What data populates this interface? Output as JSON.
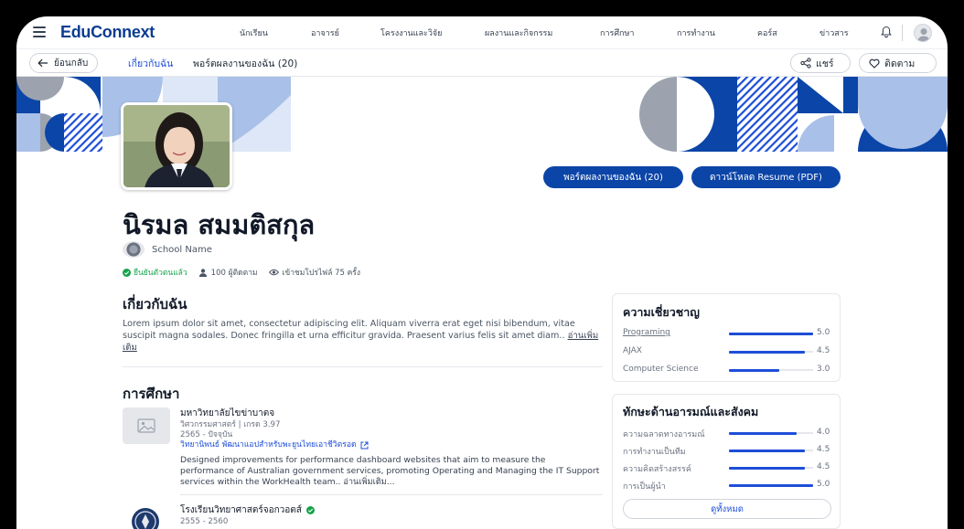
{
  "app": {
    "logo": "EduConnext"
  },
  "topnav": {
    "menu": [
      "นักเรียน",
      "อาจารย์",
      "โครงงานและวิจัย",
      "ผลงานและกิจกรรม",
      "การศึกษา",
      "การทำงาน",
      "คอร์ส",
      "ข่าวสาร"
    ]
  },
  "subnav": {
    "back_label": "ย้อนกลับ",
    "tabs": [
      {
        "label": "เกี่ยวกับฉัน",
        "active": true
      },
      {
        "label": "พอร์ตผลงานของฉัน (20)",
        "active": false
      }
    ],
    "share_label": "แชร์",
    "follow_label": "ติดตาม"
  },
  "profile": {
    "portfolio_button": "พอร์ตผลงานของฉัน (20)",
    "resume_button": "ดาวน์โหลด Resume (PDF)",
    "name": "นิรมล สมมติสกุล",
    "school": "School Name",
    "verified": "ยืนยันตัวตนแล้ว",
    "followers": "100 ผู้ติดตาม",
    "views": "เข้าชมโปรไฟล์ 75 ครั้ง"
  },
  "about": {
    "title": "เกี่ยวกับฉัน",
    "text": "Lorem ipsum dolor sit amet, consectetur adipiscing elit. Aliquam viverra erat eget nisi bibendum, vitae suscipit magna sodales. Donec fringilla et urna efficitur gravida. Praesent varius felis sit amet diam..",
    "readmore": "อ่านเพิ่มเติม"
  },
  "education": {
    "title": "การศึกษา",
    "items": [
      {
        "school": "มหาวิทยาลัยไขข่าบาตจ",
        "degree": "วิศวกรรมศาสตร์ | เกรด 3.97",
        "years": "2565 - ปัจจุบัน",
        "thesis": "วิทยานิพนธ์ พัฒนาแอปสำหรับพะยูนไทยเอาชีวิตรอด",
        "description": "Designed improvements for performance dashboard websites that aim to measure the performance of Australian government services, promoting Operating and Managing the IT Support services within the WorkHealth team..",
        "readmore": "อ่านเพิ่มเติม..."
      },
      {
        "school": "โรงเรียนวิทยาศาสตร์จอกวอตส์",
        "years": "2555 - 2560"
      }
    ]
  },
  "expertise": {
    "title": "ความเชี่ยวชาญ",
    "items": [
      {
        "label": "Programing",
        "value": "5.0",
        "score": 5.0,
        "link": true
      },
      {
        "label": "AJAX",
        "value": "4.5",
        "score": 4.5,
        "link": false
      },
      {
        "label": "Computer Science",
        "value": "3.0",
        "score": 3.0,
        "link": false
      }
    ]
  },
  "soft_skills": {
    "title": "ทักษะด้านอารมณ์และสังคม",
    "items": [
      {
        "label": "ความฉลาดทางอารมณ์",
        "value": "4.0",
        "score": 4.0
      },
      {
        "label": "การทำงานเป็นทีม",
        "value": "4.5",
        "score": 4.5
      },
      {
        "label": "ความคิดสร้างสรรค์",
        "value": "4.5",
        "score": 4.5
      },
      {
        "label": "การเป็นผู้นำ",
        "value": "5.0",
        "score": 5.0
      }
    ],
    "see_all": "ดูทั้งหมด"
  },
  "colors": {
    "primary": "#0b45a8",
    "accent": "#1d4ed8",
    "verified": "#16a34a"
  }
}
